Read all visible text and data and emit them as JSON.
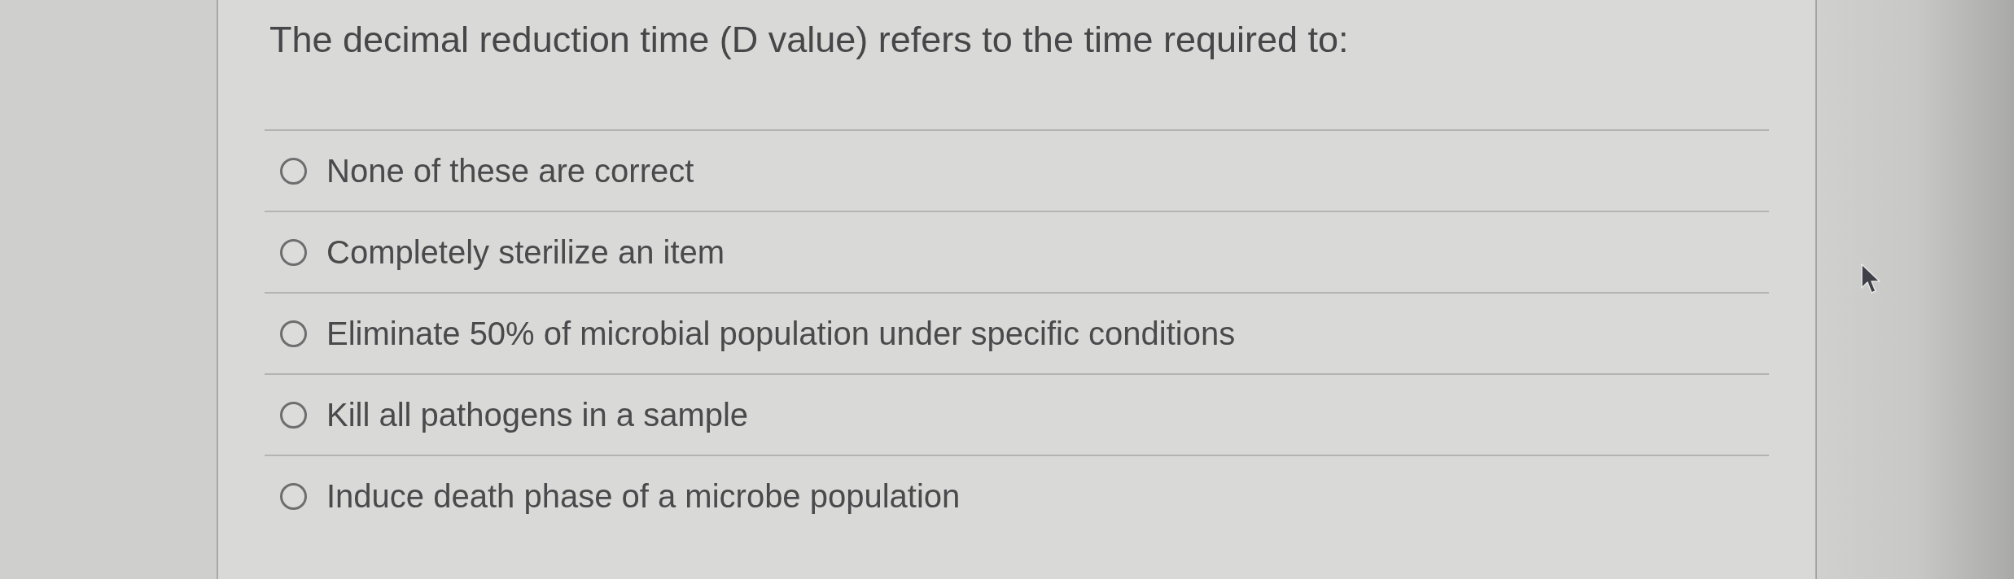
{
  "question": {
    "text": "The decimal reduction time (D value) refers to the time required to:"
  },
  "options": [
    {
      "label": "None of these are correct",
      "selected": false
    },
    {
      "label": "Completely sterilize an item",
      "selected": false
    },
    {
      "label": "Eliminate 50% of microbial population under specific conditions",
      "selected": false
    },
    {
      "label": "Kill all pathogens in a sample",
      "selected": false
    },
    {
      "label": "Induce death phase of a microbe population",
      "selected": false
    }
  ]
}
